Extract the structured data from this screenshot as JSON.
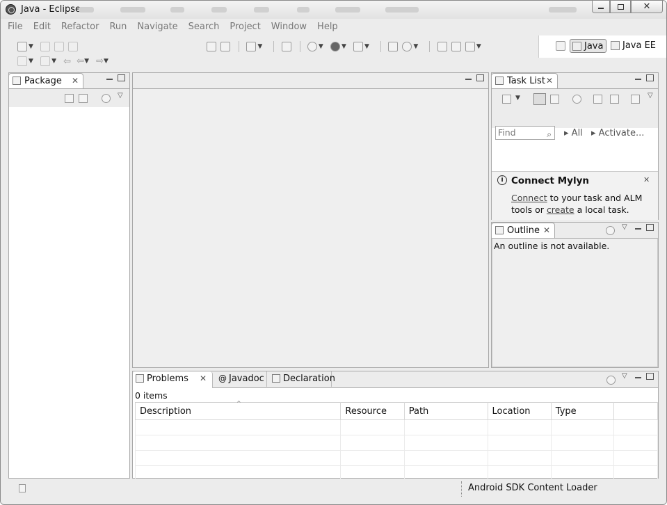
{
  "window": {
    "title": "Java - Eclipse",
    "controls": [
      "minimize",
      "restore",
      "close"
    ]
  },
  "menu": [
    "File",
    "Edit",
    "Refactor",
    "Run",
    "Navigate",
    "Search",
    "Project",
    "Window",
    "Help"
  ],
  "perspectives": [
    {
      "label": "Java",
      "active": true,
      "icon": "java-perspective-icon"
    },
    {
      "label": "Java EE",
      "active": false,
      "icon": "javaee-perspective-icon"
    }
  ],
  "package_view": {
    "tab": "Package"
  },
  "task_list": {
    "tab": "Task List",
    "find_placeholder": "Find",
    "filter_all": "All",
    "activate": "Activate..."
  },
  "mylyn": {
    "title": "Connect Mylyn",
    "connect_link": "Connect",
    "text1": "to your task and ALM",
    "text2": "tools or",
    "create_link": "create",
    "text3": "a local task."
  },
  "outline": {
    "tab": "Outline",
    "message": "An outline is not available."
  },
  "problems": {
    "tabs": [
      {
        "label": "Problems",
        "icon": "problems-icon",
        "active": true
      },
      {
        "label": "Javadoc",
        "icon": "at-icon",
        "active": false
      },
      {
        "label": "Declaration",
        "icon": "declaration-icon",
        "active": false
      }
    ],
    "count": "0 items",
    "columns": [
      "Description",
      "Resource",
      "Path",
      "Location",
      "Type"
    ]
  },
  "status": {
    "task": "Android SDK Content Loader"
  },
  "colors": {
    "chrome": "#ececec",
    "border": "#a8a8a8",
    "panel": "#ffffff"
  }
}
